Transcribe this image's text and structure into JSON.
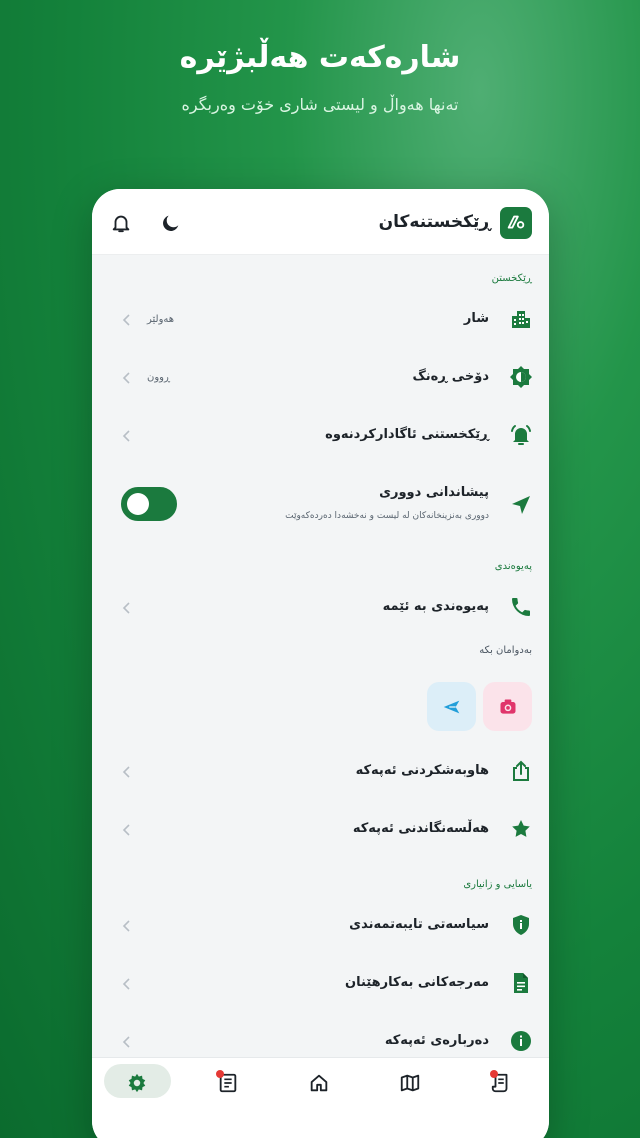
{
  "hero": {
    "title": "شارەکەت هەڵبژێرە",
    "subtitle": "تەنها هەواڵ و لیستی شاری خۆت وەربگرە"
  },
  "topbar": {
    "title": "ڕێکخستنەکان",
    "icons": [
      "app-logo",
      "moon-icon",
      "bell-icon"
    ]
  },
  "sections": {
    "settings": "ڕێکخستن",
    "contact": "پەیوەندی",
    "follow": "بەدوامان بکە",
    "legal": "یاسایی و زانیاری"
  },
  "rows": {
    "city": {
      "label": "شار",
      "value": "هەولێر"
    },
    "theme": {
      "label": "دۆخی ڕەنگ",
      "value": "ڕوون"
    },
    "notifications": {
      "label": "ڕێکخستنی ئاگادارکردنەوە"
    },
    "distance": {
      "label": "پیشاندانی دووری",
      "description": "دووری بەنزینخانەکان لە لیست و نەخشەدا دەردەکەوێت",
      "enabled": true
    },
    "contact_us": {
      "label": "پەیوەندی بە ئێمە"
    },
    "share": {
      "label": "هاوبەشکردنی ئەپەکە"
    },
    "rate": {
      "label": "هەڵسەنگاندنی ئەپەکە"
    },
    "privacy": {
      "label": "سیاسەتی تایبەتمەندی"
    },
    "terms": {
      "label": "مەرجەکانی بەکارهێنان"
    },
    "about": {
      "label": "دەربارەی ئەپەکە"
    }
  },
  "social": [
    "instagram-icon",
    "telegram-icon"
  ],
  "colors": {
    "brand_green": "#1b7a3e",
    "instagram_pink": "#e0356b",
    "telegram_blue": "#229ed9",
    "badge_red": "#e53935"
  }
}
